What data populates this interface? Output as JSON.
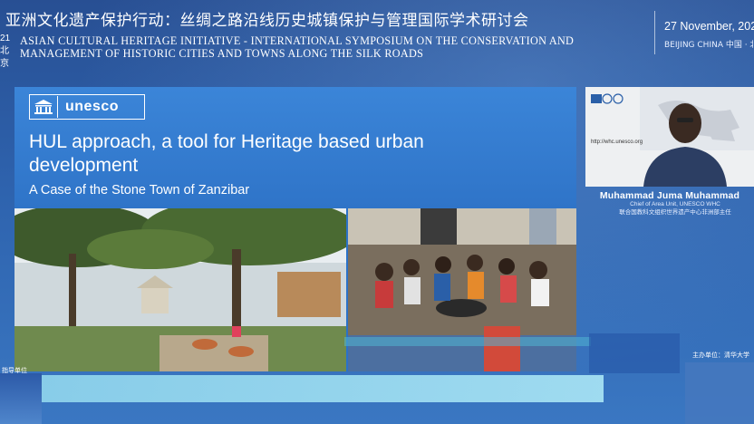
{
  "header": {
    "title_cn": "亚洲文化遗产保护行动：丝绸之路沿线历史城镇保护与管理国际学术研讨会",
    "title_en": "ASIAN CULTURAL HERITAGE INITIATIVE - INTERNATIONAL SYMPOSIUM ON THE CONSERVATION AND MANAGEMENT OF HISTORIC CITIES AND TOWNS ALONG THE SILK ROADS",
    "left_tab_line1": "21",
    "left_tab_line2": "北京",
    "date": "27 November, 202",
    "location": "BEIJING CHINA   中国 · 北"
  },
  "slide": {
    "logo_text": "unesco",
    "title": "HUL approach, a tool for Heritage based urban development",
    "subtitle": "A Case of the Stone Town of Zanzibar",
    "photo1_alt": "trees-park-photo",
    "photo2_alt": "crowd-meeting-photo"
  },
  "speaker": {
    "name": "Muhammad Juma Muhammad",
    "role_line1": "Chief of Area Unit, UNESCO WHC",
    "role_line2": "联合国教科文组织世界遗产中心非洲部主任",
    "url": "http://whc.unesco.org"
  },
  "footer": {
    "left_text": "指导单位",
    "org_line1": "主办单位：清华大学",
    "org_line2": ""
  },
  "colors": {
    "background": "#2d5ea8",
    "slide_blue": "#2f74c8",
    "bottom_bar": "#a8e0ef"
  }
}
